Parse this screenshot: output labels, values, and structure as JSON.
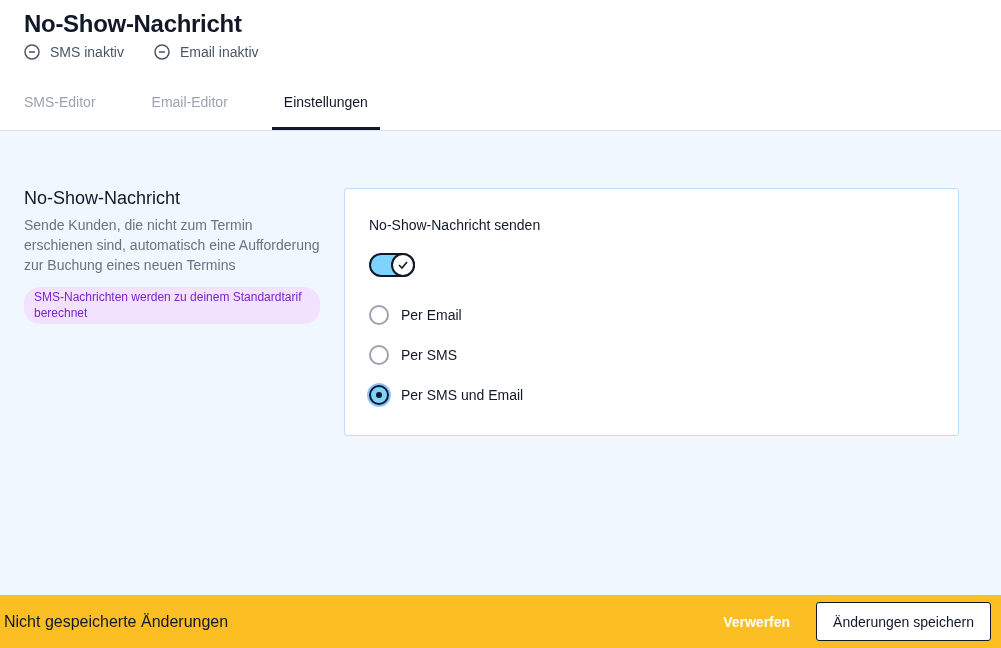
{
  "header": {
    "title": "No-Show-Nachricht",
    "statuses": [
      {
        "label": "SMS inaktiv"
      },
      {
        "label": "Email inaktiv"
      }
    ]
  },
  "tabs": [
    {
      "label": "SMS-Editor",
      "selected": false
    },
    {
      "label": "Email-Editor",
      "selected": false
    },
    {
      "label": "Einstellungen",
      "selected": true
    }
  ],
  "section": {
    "title": "No-Show-Nachricht",
    "description": "Sende Kunden, die nicht zum Termin erschienen sind, automatisch eine Aufforderung zur Buchung eines neuen Termins",
    "notice": "SMS-Nachrichten werden zu deinem Standardtarif berechnet"
  },
  "card": {
    "toggle_label": "No-Show-Nachricht senden",
    "toggle_on": true,
    "options": [
      {
        "label": "Per Email",
        "selected": false
      },
      {
        "label": "Per SMS",
        "selected": false
      },
      {
        "label": "Per SMS und Email",
        "selected": true
      }
    ]
  },
  "footer": {
    "message": "Nicht gespeicherte Änderungen",
    "discard": "Verwerfen",
    "save": "Änderungen speichern"
  }
}
